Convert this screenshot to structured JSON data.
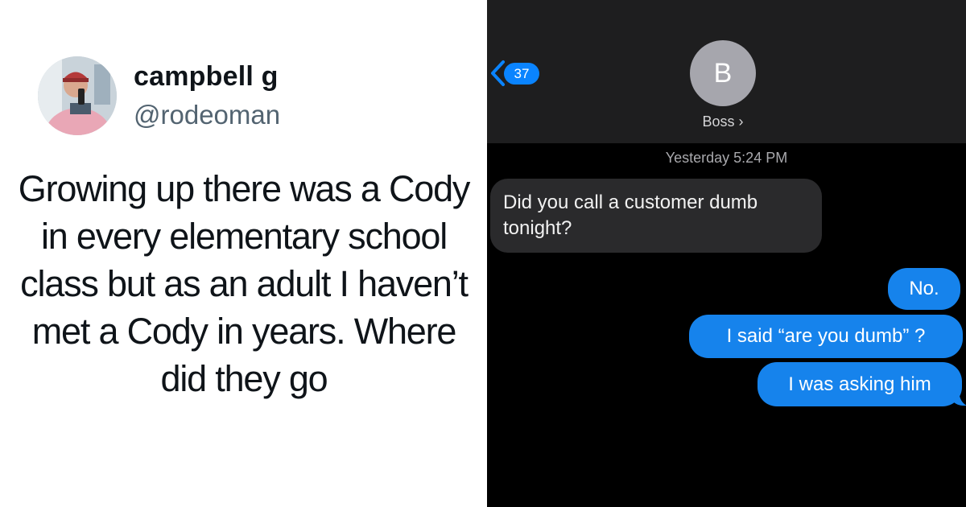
{
  "tweet": {
    "display_name": "campbell g",
    "handle": "@rodeoman",
    "text": "Growing up there was a Cody in every elementary school class but as an adult I haven’t met a Cody in years. Where did they go"
  },
  "imessage": {
    "back_count": "37",
    "contact_initial": "B",
    "contact_name": "Boss ›",
    "timestamp": "Yesterday 5:24 PM",
    "messages": [
      {
        "from": "contact",
        "text": "Did you call a customer dumb tonight?"
      },
      {
        "from": "me",
        "text": "No."
      },
      {
        "from": "me",
        "text": "I said “are you dumb” ?"
      },
      {
        "from": "me",
        "text": "I was asking him"
      }
    ],
    "colors": {
      "sent_bubble": "#1683ec",
      "received_bubble": "#2a2a2c",
      "badge": "#0a84ff"
    }
  }
}
